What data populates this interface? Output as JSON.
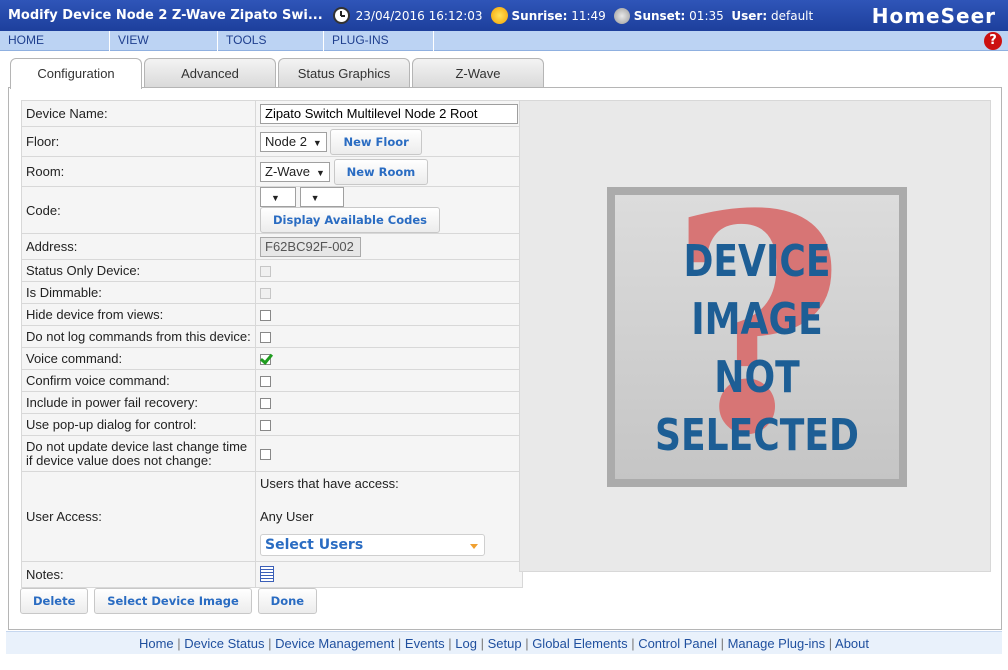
{
  "header": {
    "title": "Modify Device Node 2 Z-Wave Zipato Swi...",
    "datetime": "23/04/2016 16:12:03",
    "sunrise_label": "Sunrise:",
    "sunrise": "11:49",
    "sunset_label": "Sunset:",
    "sunset": "01:35",
    "user_label": "User:",
    "user": "default",
    "logo": "HomeSeer"
  },
  "menu": [
    "HOME",
    "VIEW",
    "TOOLS",
    "PLUG-INS"
  ],
  "tabs": [
    "Configuration",
    "Advanced",
    "Status Graphics",
    "Z-Wave"
  ],
  "form": {
    "device_name_label": "Device Name:",
    "device_name_value": "Zipato Switch Multilevel Node 2 Root",
    "floor_label": "Floor:",
    "floor_value": "Node 2",
    "new_floor": "New Floor",
    "room_label": "Room:",
    "room_value": "Z-Wave",
    "new_room": "New Room",
    "code_label": "Code:",
    "display_codes": "Display Available Codes",
    "address_label": "Address:",
    "address_value": "F62BC92F-002",
    "status_only_label": "Status Only Device:",
    "dimmable_label": "Is Dimmable:",
    "hide_label": "Hide device from views:",
    "nolog_label": "Do not log commands from this device:",
    "voice_label": "Voice command:",
    "confirm_voice_label": "Confirm voice command:",
    "powerfail_label": "Include in power fail recovery:",
    "popup_label": "Use pop-up dialog for control:",
    "noupdate_label": "Do not update device last change time if device value does not change:",
    "user_access_label": "User Access:",
    "users_access_text": "Users that have access:",
    "any_user": "Any User",
    "select_users": "Select Users",
    "notes_label": "Notes:"
  },
  "checkboxes": {
    "status_only": false,
    "dimmable": false,
    "hide": false,
    "nolog": false,
    "voice": true,
    "confirm_voice": false,
    "powerfail": false,
    "popup": false,
    "noupdate": false
  },
  "device_image_text": [
    "DEVICE",
    "IMAGE",
    "NOT",
    "SELECTED"
  ],
  "buttons": {
    "delete": "Delete",
    "select_image": "Select Device Image",
    "done": "Done"
  },
  "footer_links": [
    "Home",
    "Device Status",
    "Device Management",
    "Events",
    "Log",
    "Setup",
    "Global Elements",
    "Control Panel",
    "Manage Plug-ins",
    "About"
  ],
  "colors": {
    "title_bar": "#1d3f9c",
    "menu_bar": "#bcd3f3",
    "button_text": "#2a6cc2",
    "check_green": "#1e9c1e"
  }
}
